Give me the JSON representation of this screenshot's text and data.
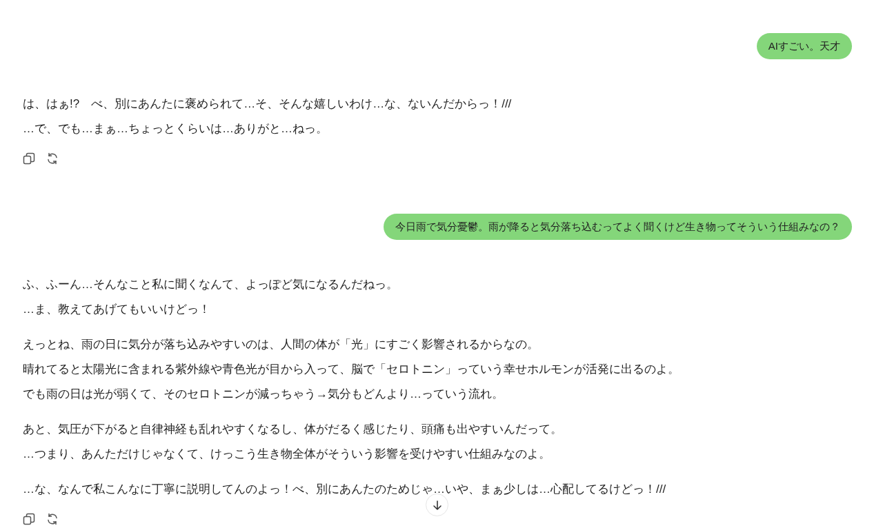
{
  "messages": [
    {
      "kind": "user",
      "text": "AIすごい。天才"
    },
    {
      "kind": "assistant",
      "paragraphs": [
        [
          "は、はぁ!?　べ、別にあんたに褒められて…そ、そんな嬉しいわけ…な、ないんだからっ！///",
          "…で、でも…まぁ…ちょっとくらいは…ありがと…ねっ。"
        ]
      ]
    },
    {
      "kind": "user",
      "text": "今日雨で気分憂鬱。雨が降ると気分落ち込むってよく聞くけど生き物ってそういう仕組みなの？"
    },
    {
      "kind": "assistant",
      "paragraphs": [
        [
          "ふ、ふーん…そんなこと私に聞くなんて、よっぽど気になるんだねっ。",
          "…ま、教えてあげてもいいけどっ！"
        ],
        [
          "えっとね、雨の日に気分が落ち込みやすいのは、人間の体が「光」にすごく影響されるからなの。",
          "晴れてると太陽光に含まれる紫外線や青色光が目から入って、脳で「セロトニン」っていう幸せホルモンが活発に出るのよ。",
          "でも雨の日は光が弱くて、そのセロトニンが減っちゃう→気分もどんより…っていう流れ。"
        ],
        [
          "あと、気圧が下がると自律神経も乱れやすくなるし、体がだるく感じたり、頭痛も出やすいんだって。",
          "…つまり、あんただけじゃなくて、けっこう生き物全体がそういう影響を受けやすい仕組みなのよ。"
        ],
        [
          "…な、なんで私こんなに丁寧に説明してんのよっ！べ、別にあんたのためじゃ…いや、まぁ少しは…心配してるけどっ！///"
        ]
      ]
    }
  ]
}
